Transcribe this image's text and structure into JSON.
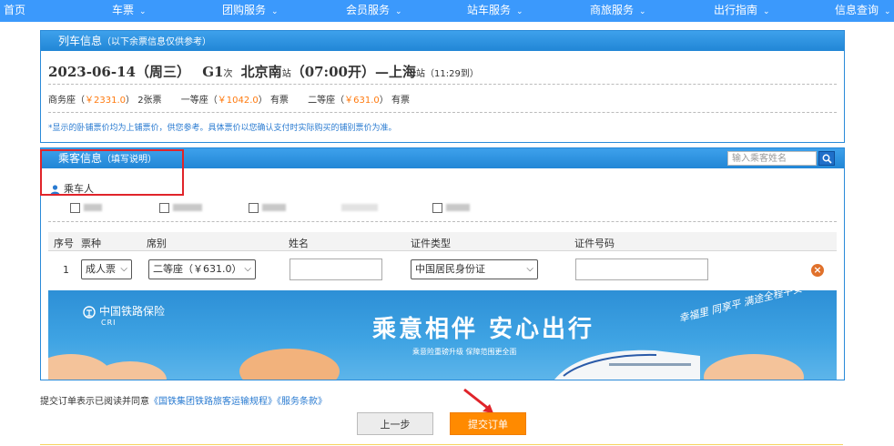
{
  "nav": {
    "items": [
      "首页",
      "车票",
      "团购服务",
      "会员服务",
      "站车服务",
      "商旅服务",
      "出行指南",
      "信息查询"
    ]
  },
  "train_panel": {
    "title": "列车信息",
    "subtitle": "（以下余票信息仅供参考）",
    "date": "2023-06-14（周三）",
    "train_no": "G1",
    "train_no_suffix": "次",
    "from": "北京南",
    "from_suffix": "站",
    "depart": "（07:00开）",
    "dash": "—",
    "to": "上海",
    "to_suffix": "站",
    "arrive": "（11:29到）",
    "seats": [
      {
        "name": "商务座（",
        "price": "￥2331.0",
        "close": "）",
        "status": "2张票"
      },
      {
        "name": "一等座（",
        "price": "￥1042.0",
        "close": "）",
        "status": "有票"
      },
      {
        "name": "二等座（",
        "price": "￥631.0",
        "close": "）",
        "status": "有票"
      }
    ],
    "note": "*显示的卧铺票价均为上铺票价，供您参考。具体票价以您确认支付时实际购买的铺别票价为准。"
  },
  "passenger_panel": {
    "title": "乘客信息",
    "subtitle": "（填写说明）",
    "search_placeholder": "输入乘客姓名",
    "passenger_label": "乘车人",
    "table_headers": {
      "seq": "序号",
      "ticket_type": "票种",
      "seat_class": "席别",
      "name": "姓名",
      "id_type": "证件类型",
      "id_no": "证件号码"
    },
    "row": {
      "seq": "1",
      "ticket_type": "成人票",
      "seat_class": "二等座（￥631.0）",
      "id_type": "中国居民身份证"
    },
    "banner": {
      "logo": "中国铁路保险",
      "logo_sub": "CRI",
      "slogan": "乘意相伴 安心出行",
      "slogan_sub": "乘意险重磅升级 保障范围更全面",
      "handwriting": "幸福里 同享平 满途全程平安"
    }
  },
  "agreement": {
    "prefix": "提交订单表示已阅读并同意",
    "link1": "《国铁集团铁路旅客运输规程》",
    "link2": "《服务条款》"
  },
  "buttons": {
    "prev": "上一步",
    "submit": "提交订单"
  },
  "colors": {
    "nav": "#3b99fc",
    "price": "#ff7a0f",
    "submit": "#ff8a00",
    "highlight": "#e0242a"
  }
}
